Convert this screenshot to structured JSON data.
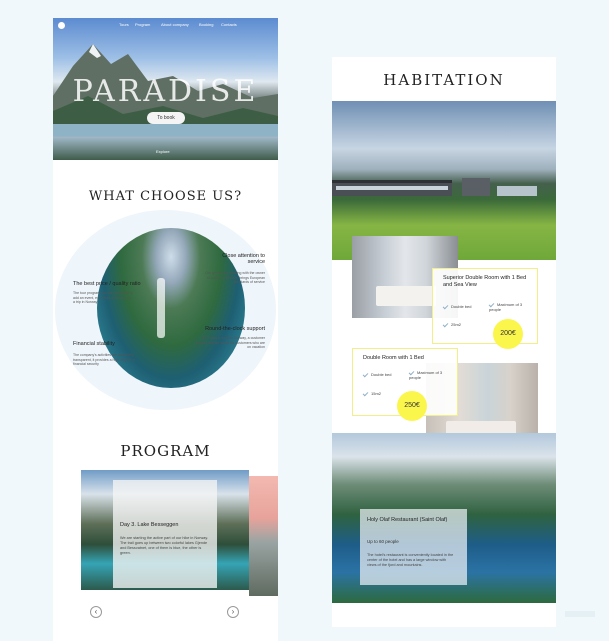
{
  "left_page": {
    "nav": {
      "items": [
        "Tours",
        "Program",
        "About company",
        "Booking",
        "Contacts"
      ]
    },
    "hero": {
      "title": "PARADISE",
      "book_button": "To book",
      "scroll_label": "Explore"
    },
    "why": {
      "title": "WHAT CHOOSE US?",
      "features": [
        {
          "title": "The best price / quality ratio",
          "desc": "The tour program has the possibility to add an event, excursion or the tour to a trip in Norway"
        },
        {
          "title": "Close attention to service",
          "desc": "Our guides are working with the owner of a team of service, brings European standards of service"
        },
        {
          "title": "Round-the-clock support",
          "desc": "24/7 days a week in Norway, a customer support service works for customers who are on vacation"
        },
        {
          "title": "Financial stability",
          "desc": "The company's activities are absolutely transparent, it provides a high degree of financial security"
        }
      ]
    },
    "program": {
      "title": "PROGRAM",
      "day": "Day 3. Lake Besseggen",
      "desc": "We are starting the active part of our hike in Norway. The trail goes up between two colorful lakes Gjende and Bessvatnet, one of them is blue, the other is green.",
      "prev_icon": "chevron-left-icon",
      "next_icon": "chevron-right-icon"
    }
  },
  "right_page": {
    "title": "HABITATION",
    "rooms": [
      {
        "name": "Superior Double Room with 1 Bed and Sea View",
        "amenities": [
          "Double bed",
          "Maximum of 3 people",
          "25m2"
        ],
        "price": "200€"
      },
      {
        "name": "Double Room with 1 Bed",
        "amenities": [
          "Double bed",
          "Maximum of 3 people",
          "15m2"
        ],
        "price": "250€"
      }
    ],
    "restaurant": {
      "title": "Holy Olaf Restaurant (Saint Olaf)",
      "capacity": "Up to 60 people",
      "desc": "The hotel's restaurant is conveniently located in the center of the hotel and has a large window with views of the fjord and mountains."
    }
  },
  "colors": {
    "accent_yellow": "#fbf64c",
    "background": "#f1f8fb",
    "card_border": "#f2ee8a"
  }
}
